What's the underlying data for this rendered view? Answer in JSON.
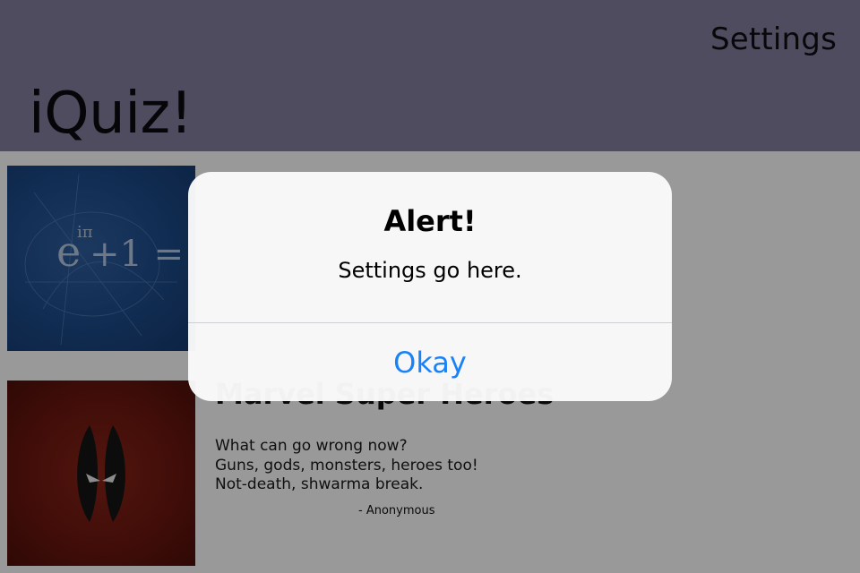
{
  "nav": {
    "settings_label": "Settings",
    "title": "iQuiz!"
  },
  "quizzes": [
    {
      "image": "euler-identity-image",
      "image_text": "e^iπ + 1 = 0",
      "title": "",
      "description": [],
      "attribution": ""
    },
    {
      "image": "deadpool-mask-image",
      "title": "Marvel Super Heroes",
      "description": [
        "What can go wrong now?",
        "Guns, gods, monsters, heroes too!",
        "Not-death, shwarma break."
      ],
      "attribution": "- Anonymous"
    }
  ],
  "alert": {
    "title": "Alert!",
    "message": "Settings go here.",
    "button_label": "Okay"
  },
  "colors": {
    "nav_background": "#847f9e",
    "alert_button": "#1a82f7",
    "dim_overlay": "rgba(0,0,0,0.4)"
  }
}
